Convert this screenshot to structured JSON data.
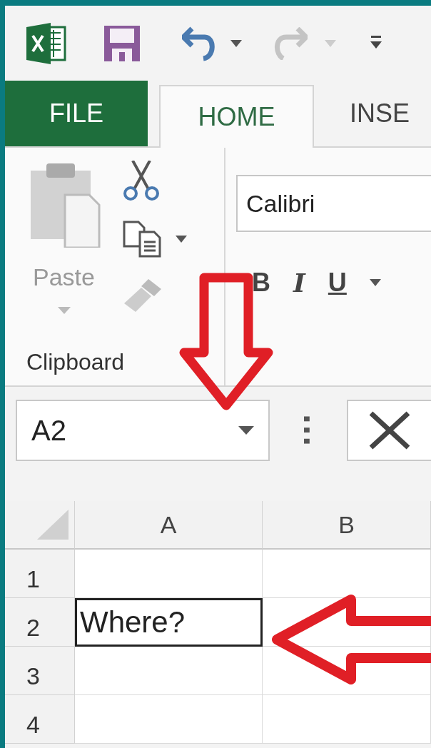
{
  "tabs": [
    {
      "label": "FILE",
      "kind": "file",
      "selected": false
    },
    {
      "label": "HOME",
      "kind": "tab",
      "selected": true
    },
    {
      "label": "INSE",
      "kind": "tab",
      "selected": false
    }
  ],
  "clipboard": {
    "paste_label": "Paste",
    "group_label": "Clipboard"
  },
  "font": {
    "value": "Calibri",
    "format_buttons": [
      "B",
      "I",
      "U"
    ]
  },
  "name_box": {
    "value": "A2"
  },
  "columns": [
    "A",
    "B"
  ],
  "rows": [
    {
      "number": "1",
      "selected": false
    },
    {
      "number": "2",
      "a": "Where?",
      "selected": true
    },
    {
      "number": "3",
      "selected": false
    },
    {
      "number": "4",
      "selected": false
    }
  ]
}
